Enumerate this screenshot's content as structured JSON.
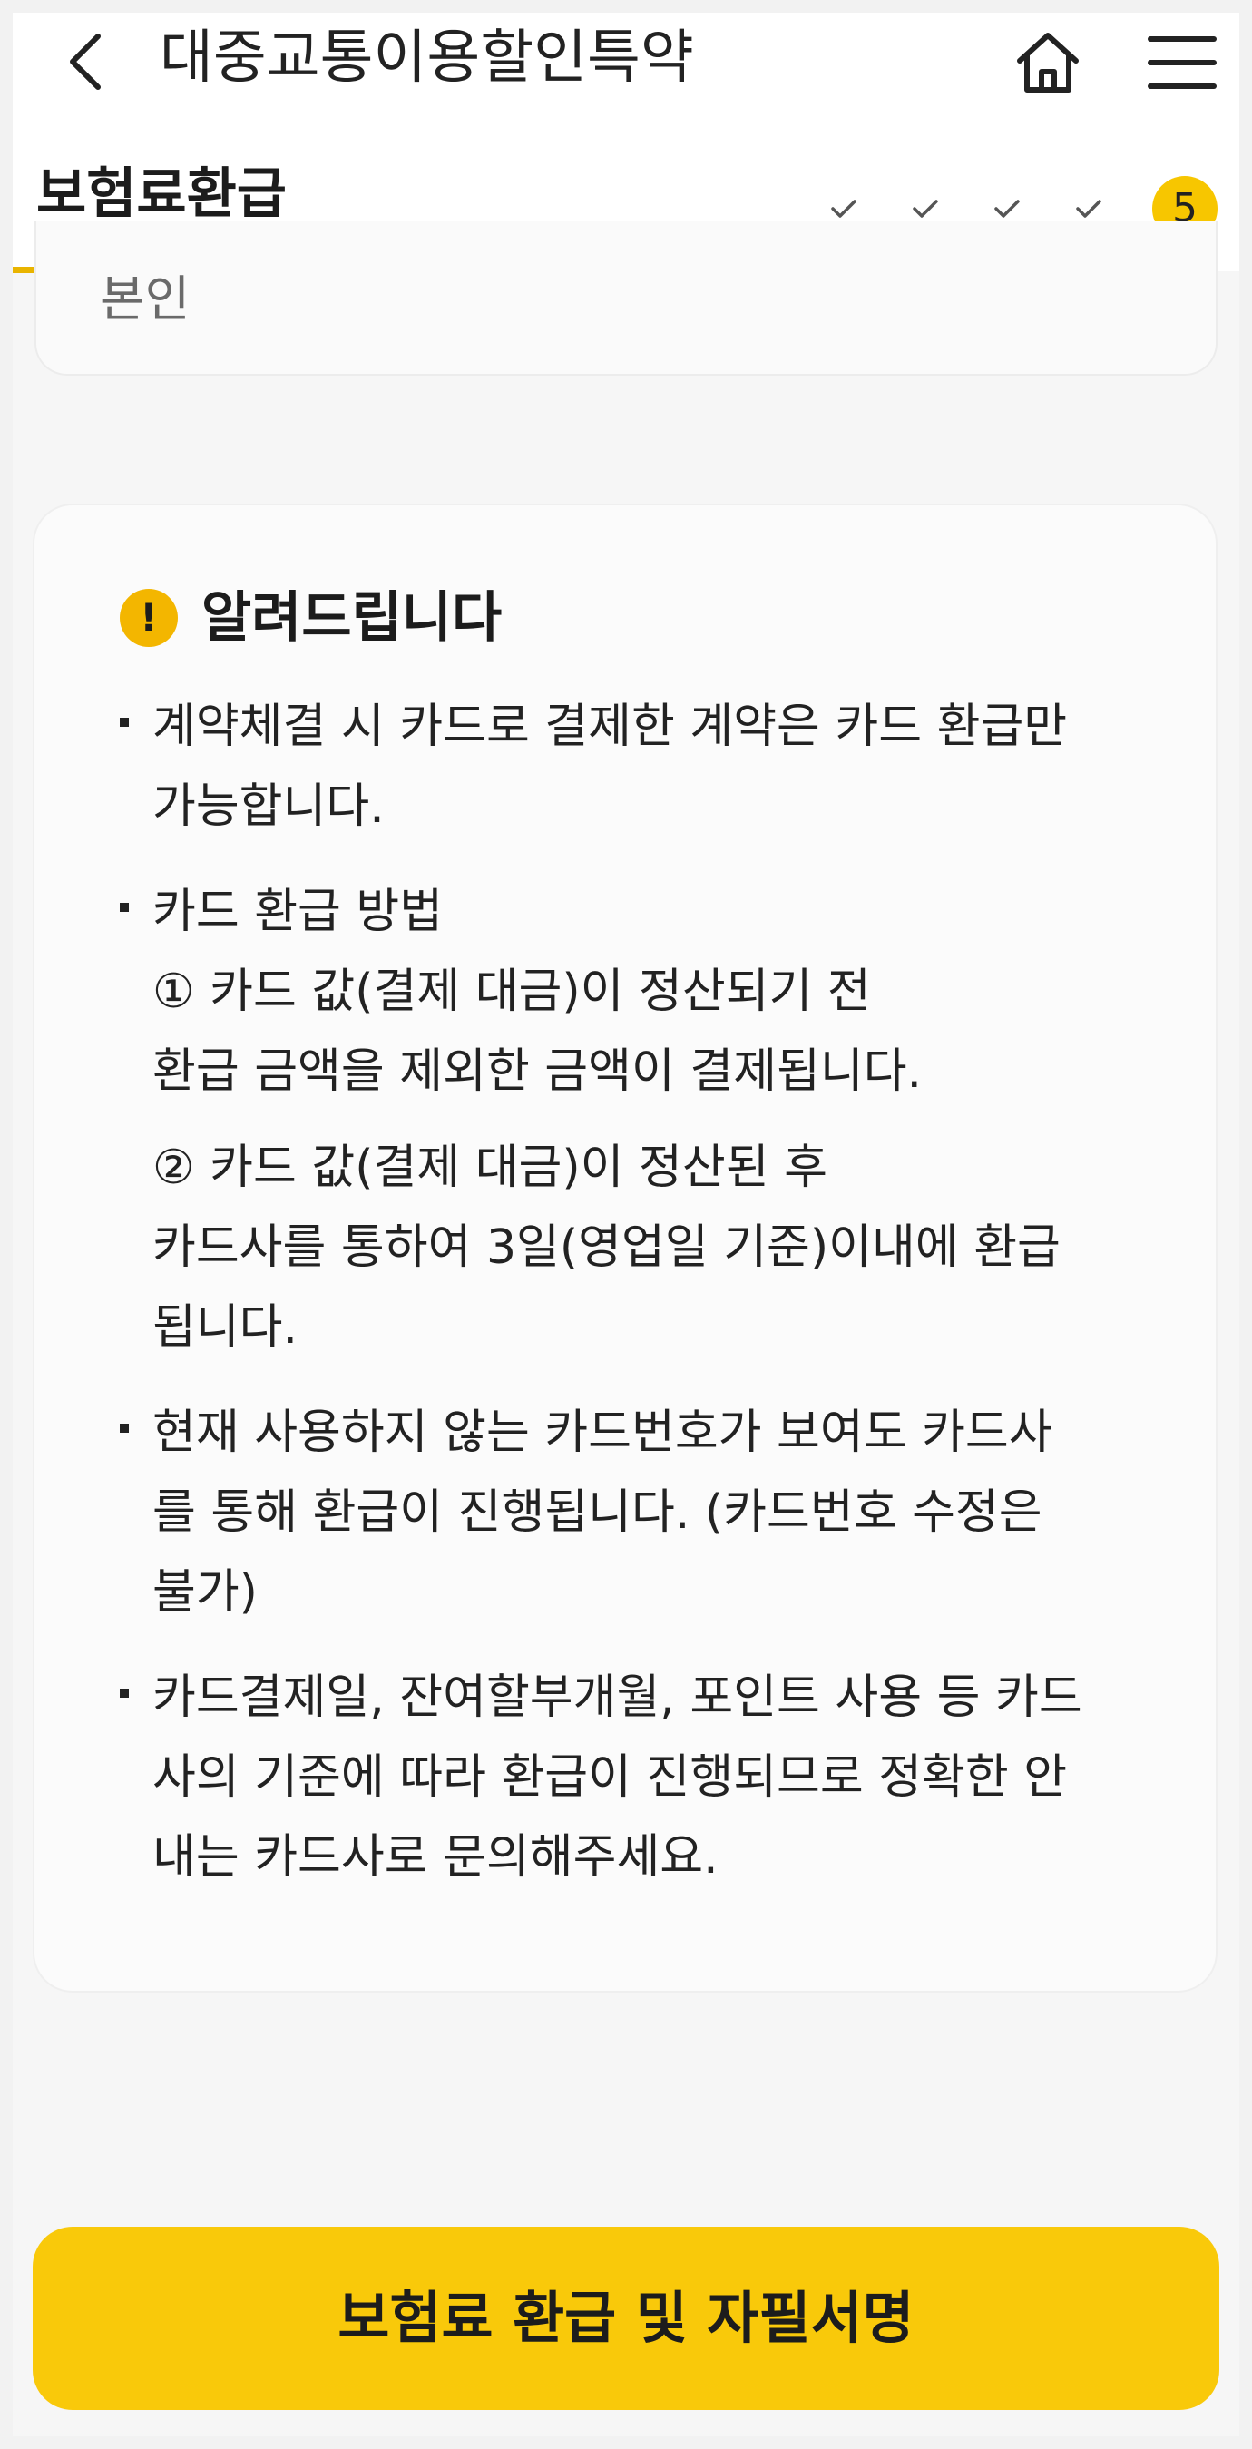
{
  "header": {
    "title": "대중교통이용할인특약",
    "back_icon": "chevron-left-icon",
    "home_icon": "home-icon",
    "menu_icon": "hamburger-menu-icon"
  },
  "step": {
    "title": "보험료환급",
    "completed_count": 4,
    "current_number": "5",
    "progress_fraction": 0.72,
    "accent_color": "#f7c600"
  },
  "previous_card": {
    "text": "본인"
  },
  "notice": {
    "title": "알려드립니다",
    "icon_text": "!",
    "items": [
      {
        "lines": [
          "계약체결 시 카드로 결제한 계약은 카드 환급만",
          "가능합니다."
        ]
      },
      {
        "lines": [
          "카드 환급 방법",
          "① 카드 값(결제 대금)이 정산되기 전",
          "환급 금액을 제외한 금액이 결제됩니다."
        ],
        "extra_lines": [
          "② 카드 값(결제 대금)이 정산된 후",
          "카드사를 통하여 3일(영업일 기준)이내에 환급",
          "됩니다."
        ]
      },
      {
        "lines": [
          "현재 사용하지 않는 카드번호가 보여도 카드사",
          "를 통해 환급이 진행됩니다. (카드번호 수정은",
          "불가)"
        ]
      },
      {
        "lines": [
          "카드결제일, 잔여할부개월, 포인트 사용 등 카드",
          "사의 기준에 따라 환급이 진행되므로 정확한 안",
          "내는 카드사로 문의해주세요."
        ]
      }
    ]
  },
  "cta": {
    "label": "보험료 환급 및 자필서명",
    "color": "#f9c90a"
  }
}
